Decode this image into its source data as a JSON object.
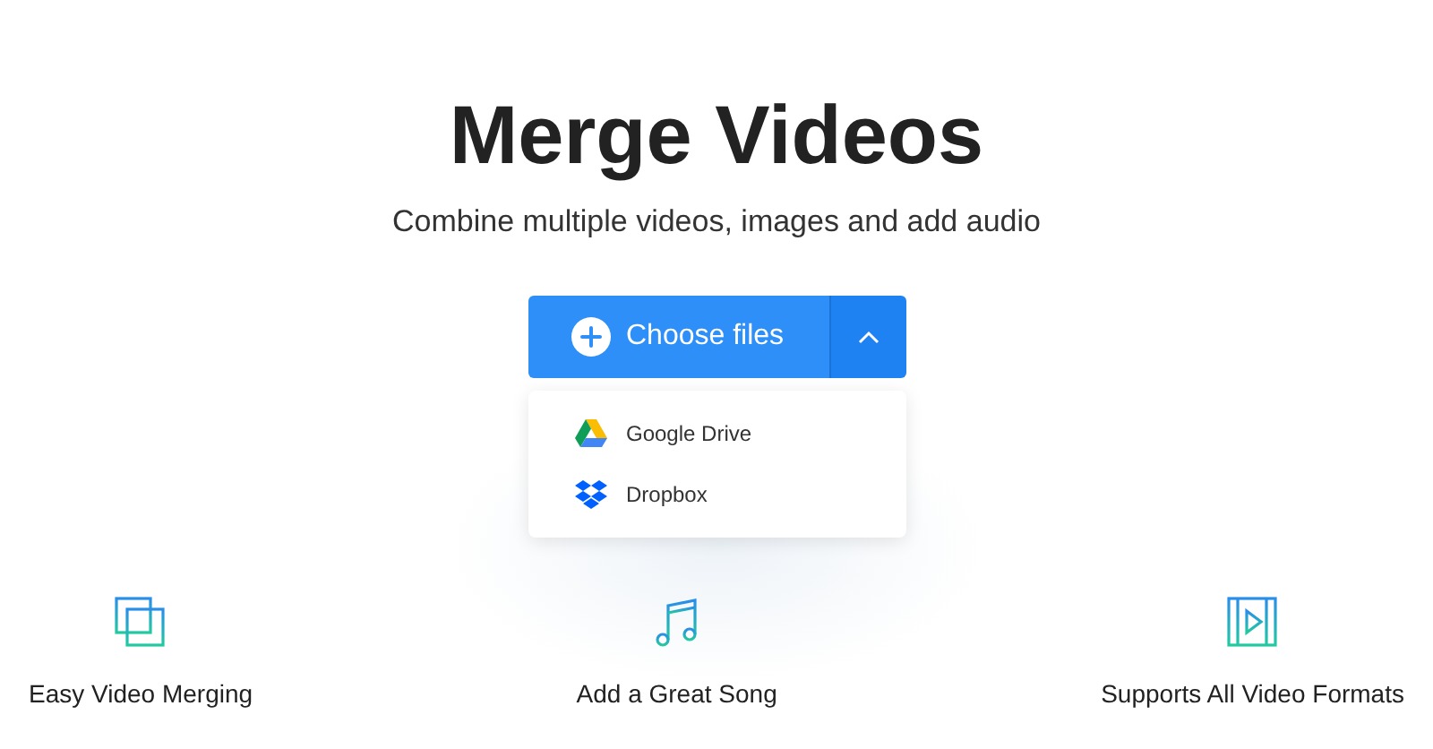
{
  "header": {
    "title": "Merge Videos",
    "subtitle": "Combine multiple videos, images and add audio"
  },
  "upload": {
    "label": "Choose files",
    "expanded": true,
    "sources": [
      {
        "label": "Google Drive",
        "kind": "drive"
      },
      {
        "label": "Dropbox",
        "kind": "dropbox"
      }
    ]
  },
  "features": [
    {
      "label": "Easy Video Merging",
      "kind": "merge"
    },
    {
      "label": "Add a Great Song",
      "kind": "music"
    },
    {
      "label": "Supports All Video Formats",
      "kind": "video"
    }
  ]
}
